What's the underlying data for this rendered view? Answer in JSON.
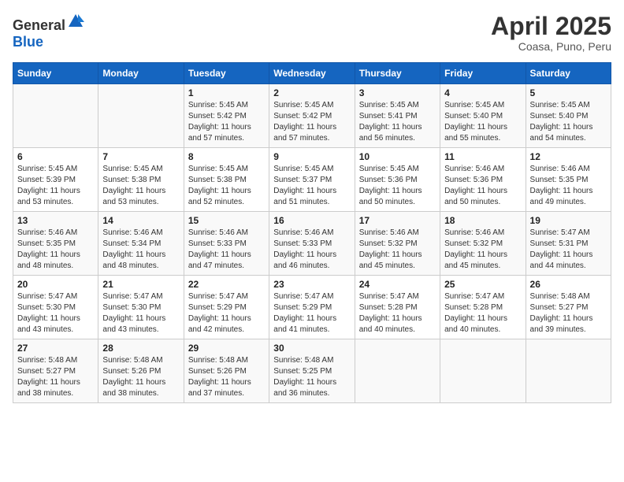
{
  "header": {
    "logo_general": "General",
    "logo_blue": "Blue",
    "title": "April 2025",
    "subtitle": "Coasa, Puno, Peru"
  },
  "days_of_week": [
    "Sunday",
    "Monday",
    "Tuesday",
    "Wednesday",
    "Thursday",
    "Friday",
    "Saturday"
  ],
  "weeks": [
    [
      {
        "day": "",
        "sunrise": "",
        "sunset": "",
        "daylight": ""
      },
      {
        "day": "",
        "sunrise": "",
        "sunset": "",
        "daylight": ""
      },
      {
        "day": "1",
        "sunrise": "Sunrise: 5:45 AM",
        "sunset": "Sunset: 5:42 PM",
        "daylight": "Daylight: 11 hours and 57 minutes."
      },
      {
        "day": "2",
        "sunrise": "Sunrise: 5:45 AM",
        "sunset": "Sunset: 5:42 PM",
        "daylight": "Daylight: 11 hours and 57 minutes."
      },
      {
        "day": "3",
        "sunrise": "Sunrise: 5:45 AM",
        "sunset": "Sunset: 5:41 PM",
        "daylight": "Daylight: 11 hours and 56 minutes."
      },
      {
        "day": "4",
        "sunrise": "Sunrise: 5:45 AM",
        "sunset": "Sunset: 5:40 PM",
        "daylight": "Daylight: 11 hours and 55 minutes."
      },
      {
        "day": "5",
        "sunrise": "Sunrise: 5:45 AM",
        "sunset": "Sunset: 5:40 PM",
        "daylight": "Daylight: 11 hours and 54 minutes."
      }
    ],
    [
      {
        "day": "6",
        "sunrise": "Sunrise: 5:45 AM",
        "sunset": "Sunset: 5:39 PM",
        "daylight": "Daylight: 11 hours and 53 minutes."
      },
      {
        "day": "7",
        "sunrise": "Sunrise: 5:45 AM",
        "sunset": "Sunset: 5:38 PM",
        "daylight": "Daylight: 11 hours and 53 minutes."
      },
      {
        "day": "8",
        "sunrise": "Sunrise: 5:45 AM",
        "sunset": "Sunset: 5:38 PM",
        "daylight": "Daylight: 11 hours and 52 minutes."
      },
      {
        "day": "9",
        "sunrise": "Sunrise: 5:45 AM",
        "sunset": "Sunset: 5:37 PM",
        "daylight": "Daylight: 11 hours and 51 minutes."
      },
      {
        "day": "10",
        "sunrise": "Sunrise: 5:45 AM",
        "sunset": "Sunset: 5:36 PM",
        "daylight": "Daylight: 11 hours and 50 minutes."
      },
      {
        "day": "11",
        "sunrise": "Sunrise: 5:46 AM",
        "sunset": "Sunset: 5:36 PM",
        "daylight": "Daylight: 11 hours and 50 minutes."
      },
      {
        "day": "12",
        "sunrise": "Sunrise: 5:46 AM",
        "sunset": "Sunset: 5:35 PM",
        "daylight": "Daylight: 11 hours and 49 minutes."
      }
    ],
    [
      {
        "day": "13",
        "sunrise": "Sunrise: 5:46 AM",
        "sunset": "Sunset: 5:35 PM",
        "daylight": "Daylight: 11 hours and 48 minutes."
      },
      {
        "day": "14",
        "sunrise": "Sunrise: 5:46 AM",
        "sunset": "Sunset: 5:34 PM",
        "daylight": "Daylight: 11 hours and 48 minutes."
      },
      {
        "day": "15",
        "sunrise": "Sunrise: 5:46 AM",
        "sunset": "Sunset: 5:33 PM",
        "daylight": "Daylight: 11 hours and 47 minutes."
      },
      {
        "day": "16",
        "sunrise": "Sunrise: 5:46 AM",
        "sunset": "Sunset: 5:33 PM",
        "daylight": "Daylight: 11 hours and 46 minutes."
      },
      {
        "day": "17",
        "sunrise": "Sunrise: 5:46 AM",
        "sunset": "Sunset: 5:32 PM",
        "daylight": "Daylight: 11 hours and 45 minutes."
      },
      {
        "day": "18",
        "sunrise": "Sunrise: 5:46 AM",
        "sunset": "Sunset: 5:32 PM",
        "daylight": "Daylight: 11 hours and 45 minutes."
      },
      {
        "day": "19",
        "sunrise": "Sunrise: 5:47 AM",
        "sunset": "Sunset: 5:31 PM",
        "daylight": "Daylight: 11 hours and 44 minutes."
      }
    ],
    [
      {
        "day": "20",
        "sunrise": "Sunrise: 5:47 AM",
        "sunset": "Sunset: 5:30 PM",
        "daylight": "Daylight: 11 hours and 43 minutes."
      },
      {
        "day": "21",
        "sunrise": "Sunrise: 5:47 AM",
        "sunset": "Sunset: 5:30 PM",
        "daylight": "Daylight: 11 hours and 43 minutes."
      },
      {
        "day": "22",
        "sunrise": "Sunrise: 5:47 AM",
        "sunset": "Sunset: 5:29 PM",
        "daylight": "Daylight: 11 hours and 42 minutes."
      },
      {
        "day": "23",
        "sunrise": "Sunrise: 5:47 AM",
        "sunset": "Sunset: 5:29 PM",
        "daylight": "Daylight: 11 hours and 41 minutes."
      },
      {
        "day": "24",
        "sunrise": "Sunrise: 5:47 AM",
        "sunset": "Sunset: 5:28 PM",
        "daylight": "Daylight: 11 hours and 40 minutes."
      },
      {
        "day": "25",
        "sunrise": "Sunrise: 5:47 AM",
        "sunset": "Sunset: 5:28 PM",
        "daylight": "Daylight: 11 hours and 40 minutes."
      },
      {
        "day": "26",
        "sunrise": "Sunrise: 5:48 AM",
        "sunset": "Sunset: 5:27 PM",
        "daylight": "Daylight: 11 hours and 39 minutes."
      }
    ],
    [
      {
        "day": "27",
        "sunrise": "Sunrise: 5:48 AM",
        "sunset": "Sunset: 5:27 PM",
        "daylight": "Daylight: 11 hours and 38 minutes."
      },
      {
        "day": "28",
        "sunrise": "Sunrise: 5:48 AM",
        "sunset": "Sunset: 5:26 PM",
        "daylight": "Daylight: 11 hours and 38 minutes."
      },
      {
        "day": "29",
        "sunrise": "Sunrise: 5:48 AM",
        "sunset": "Sunset: 5:26 PM",
        "daylight": "Daylight: 11 hours and 37 minutes."
      },
      {
        "day": "30",
        "sunrise": "Sunrise: 5:48 AM",
        "sunset": "Sunset: 5:25 PM",
        "daylight": "Daylight: 11 hours and 36 minutes."
      },
      {
        "day": "",
        "sunrise": "",
        "sunset": "",
        "daylight": ""
      },
      {
        "day": "",
        "sunrise": "",
        "sunset": "",
        "daylight": ""
      },
      {
        "day": "",
        "sunrise": "",
        "sunset": "",
        "daylight": ""
      }
    ]
  ]
}
